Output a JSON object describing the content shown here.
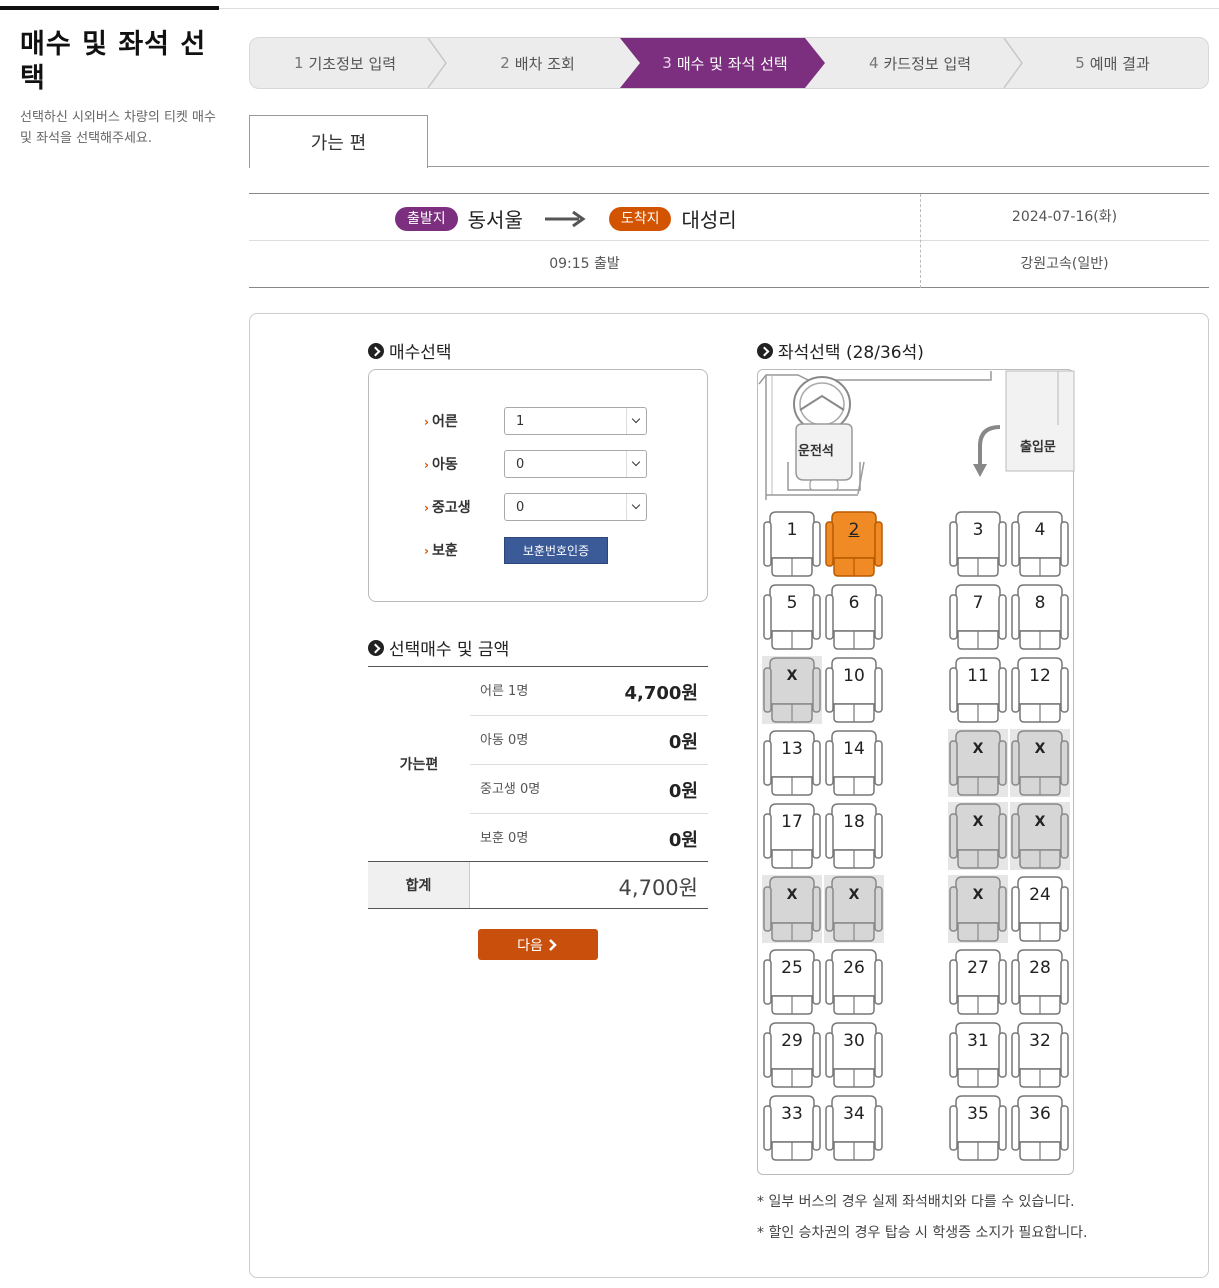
{
  "page": {
    "title": "매수 및 좌석 선택",
    "description": "선택하신 시외버스 차량의 티켓 매수 및 좌석을 선택해주세요."
  },
  "steps": [
    {
      "num": "1",
      "label": "기초정보 입력"
    },
    {
      "num": "2",
      "label": "배차 조회"
    },
    {
      "num": "3",
      "label": "매수 및 좌석 선택",
      "active": true
    },
    {
      "num": "4",
      "label": "카드정보 입력"
    },
    {
      "num": "5",
      "label": "예매 결과"
    }
  ],
  "tab": {
    "label": "가는 편"
  },
  "route": {
    "departure_badge": "출발지",
    "departure": "동서울",
    "arrival_badge": "도착지",
    "arrival": "대성리",
    "date": "2024-07-16(화)",
    "time": "09:15 출발",
    "company": "강원고속(일반)"
  },
  "count_section": {
    "title": "매수선택",
    "rows": [
      {
        "label": "어른",
        "value": "1"
      },
      {
        "label": "아동",
        "value": "0"
      },
      {
        "label": "중고생",
        "value": "0"
      }
    ],
    "veteran_label": "보훈",
    "veteran_button": "보훈번호인증"
  },
  "price_section": {
    "title": "선택매수 및 금액",
    "direction": "가는편",
    "rows": [
      {
        "label": "어른 1명",
        "value": "4,700원"
      },
      {
        "label": "아동 0명",
        "value": "0원"
      },
      {
        "label": "중고생 0명",
        "value": "0원"
      },
      {
        "label": "보훈 0명",
        "value": "0원"
      }
    ],
    "total_label": "합계",
    "total_value": "4,700원"
  },
  "next_button": "다음",
  "seat_section": {
    "title": "좌석선택 (28/36석)",
    "driver_label": "운전석",
    "door_label": "출입문",
    "sold_mark": "X",
    "selected": [
      2
    ],
    "sold": [
      9,
      15,
      16,
      19,
      20,
      21,
      22,
      23
    ],
    "total_seats": 36
  },
  "colors": {
    "accent": "#7b2f7e",
    "arrival": "#d35400",
    "selected_seat": "#f08a24",
    "next_button": "#c9500c",
    "verify_button": "#3b5a98"
  },
  "notes": [
    "* 일부 버스의 경우 실제 좌석배치와 다를 수 있습니다.",
    "* 할인 승차권의 경우 탑승 시 학생증 소지가 필요합니다."
  ]
}
